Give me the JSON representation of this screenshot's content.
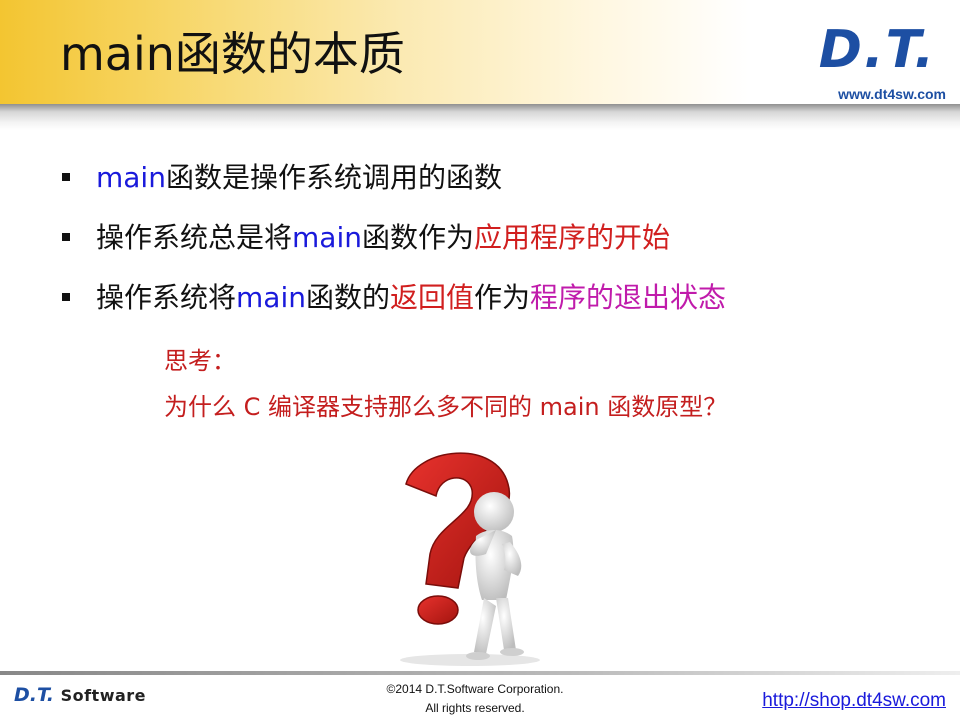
{
  "slide": {
    "title": "main函数的本质",
    "logo": {
      "mark": "D.T.",
      "url": "www.dt4sw.com"
    },
    "bullets": [
      [
        {
          "text": "main",
          "color": "blue"
        },
        {
          "text": "函数是操作系统调用的函数",
          "color": "black"
        }
      ],
      [
        {
          "text": "操作系统总是将",
          "color": "black"
        },
        {
          "text": "main",
          "color": "blue"
        },
        {
          "text": "函数作为",
          "color": "black"
        },
        {
          "text": "应用程序的开始",
          "color": "red"
        }
      ],
      [
        {
          "text": "操作系统将",
          "color": "black"
        },
        {
          "text": "main",
          "color": "blue"
        },
        {
          "text": "函数的",
          "color": "black"
        },
        {
          "text": "返回值",
          "color": "red"
        },
        {
          "text": "作为",
          "color": "black"
        },
        {
          "text": "程序的退出状态",
          "color": "magenta"
        }
      ]
    ],
    "think": {
      "label": "思考：",
      "question": "为什么 C 编译器支持那么多不同的 main 函数原型？"
    },
    "footer": {
      "logo_mark": "D.T.",
      "logo_word": "Software",
      "copyright_line1": "©2014 D.T.Software Corporation.",
      "copyright_line2": "All rights reserved.",
      "url": "http://shop.dt4sw.com"
    },
    "colors": {
      "blue": "#1a1adb",
      "red": "#d11f1f",
      "magenta": "#c01bab",
      "brand": "#1d4fa3"
    }
  }
}
